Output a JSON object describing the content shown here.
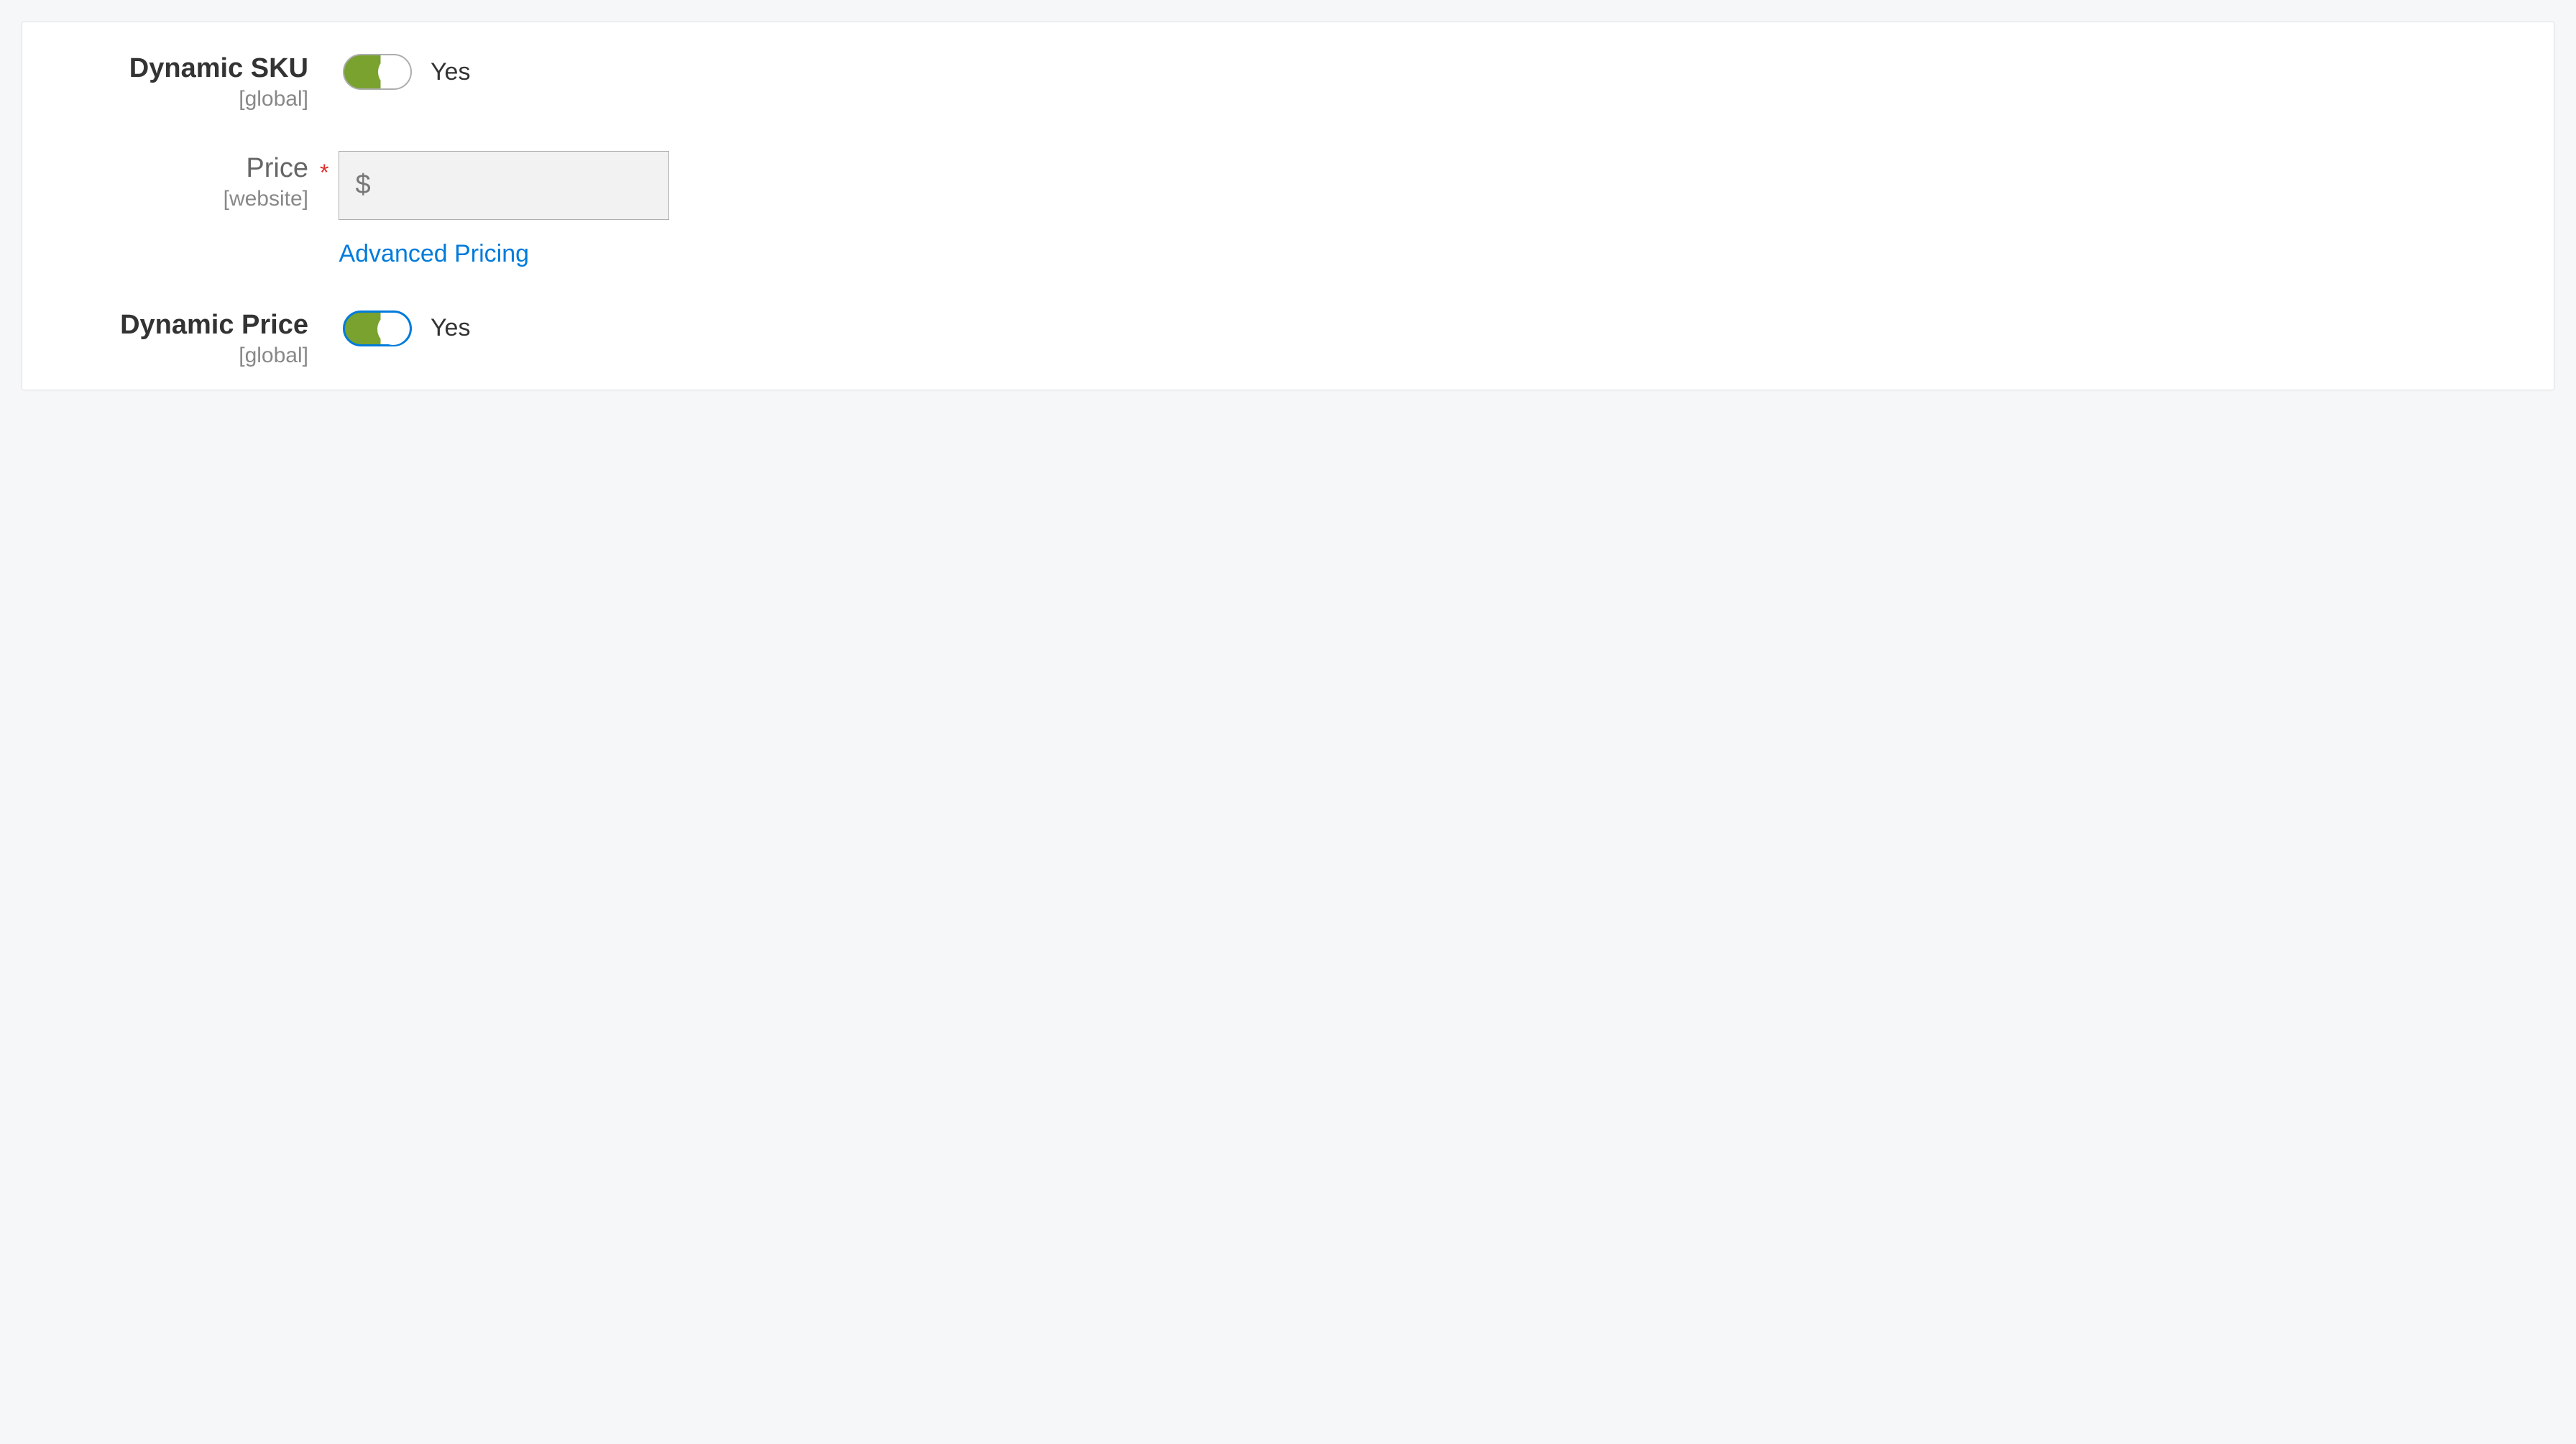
{
  "fields": {
    "dynamic_sku": {
      "label": "Dynamic SKU",
      "scope": "[global]",
      "toggle_state": "Yes"
    },
    "price": {
      "label": "Price",
      "scope": "[website]",
      "currency": "$",
      "value": "",
      "advanced_link": "Advanced Pricing"
    },
    "dynamic_price": {
      "label": "Dynamic Price",
      "scope": "[global]",
      "toggle_state": "Yes"
    }
  },
  "required_marker": "*"
}
